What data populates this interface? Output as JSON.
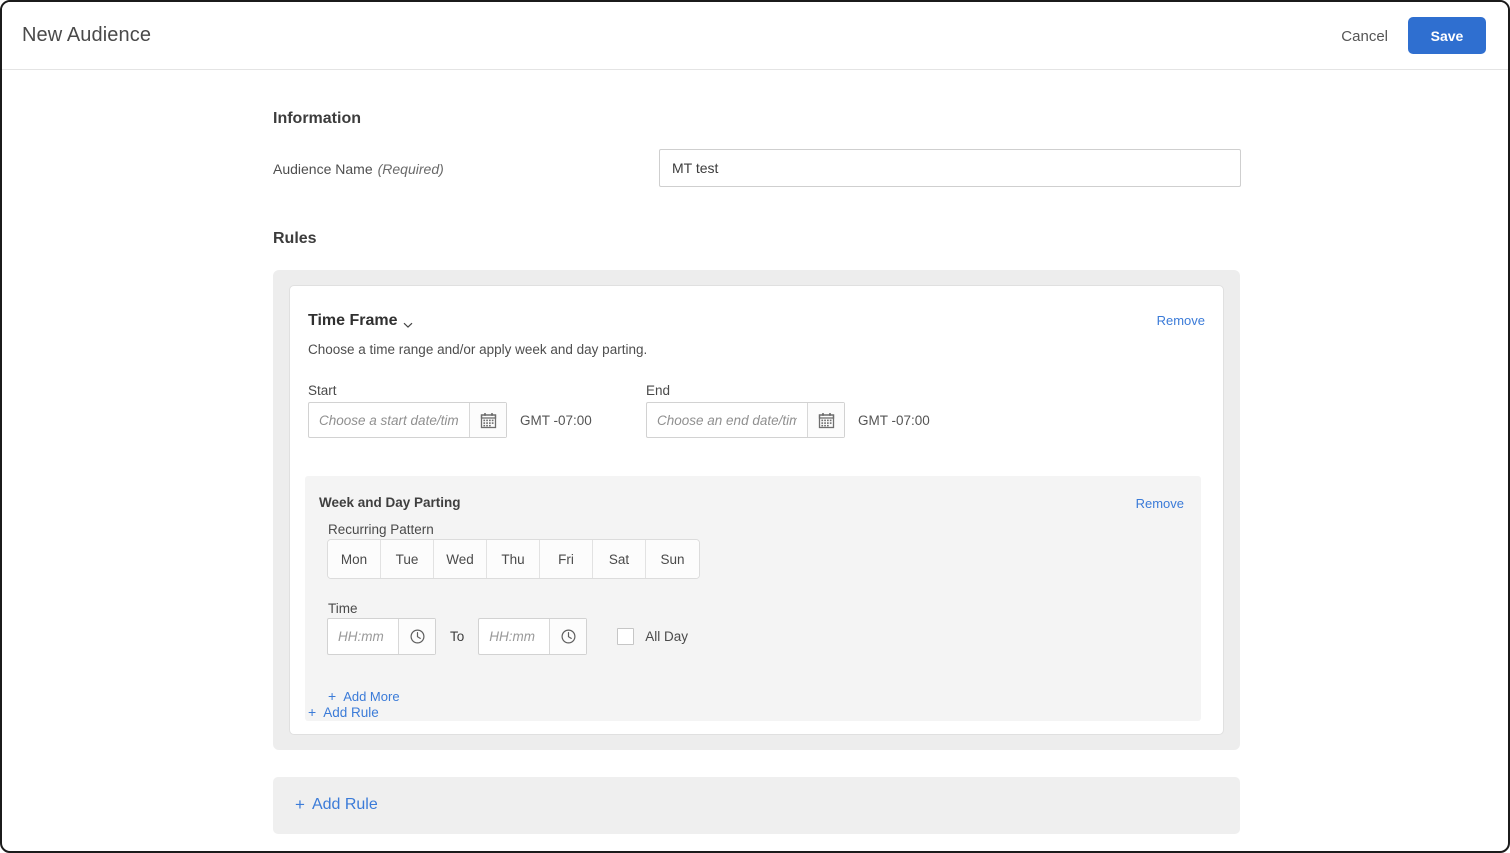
{
  "header": {
    "title": "New Audience",
    "cancel_label": "Cancel",
    "save_label": "Save"
  },
  "information": {
    "section_title": "Information",
    "audience_name": {
      "label": "Audience Name",
      "required_note": "(Required)",
      "value": "MT test",
      "placeholder": ""
    }
  },
  "rules": {
    "section_title": "Rules",
    "rule": {
      "title": "Time Frame",
      "chevron_icon": "chevron-down-icon",
      "description": "Choose a time range and/or apply week and day parting.",
      "remove_label": "Remove",
      "start": {
        "label": "Start",
        "placeholder": "Choose a start date/time",
        "value": "",
        "timezone": "GMT -07:00",
        "icon": "calendar-icon"
      },
      "end": {
        "label": "End",
        "placeholder": "Choose an end date/time",
        "value": "",
        "timezone": "GMT -07:00",
        "icon": "calendar-icon"
      },
      "parting": {
        "title": "Week and Day Parting",
        "remove_label": "Remove",
        "recurring_label": "Recurring Pattern",
        "days": [
          {
            "label": "Mon",
            "selected": false
          },
          {
            "label": "Tue",
            "selected": false
          },
          {
            "label": "Wed",
            "selected": false
          },
          {
            "label": "Thu",
            "selected": false
          },
          {
            "label": "Fri",
            "selected": false
          },
          {
            "label": "Sat",
            "selected": false
          },
          {
            "label": "Sun",
            "selected": false
          }
        ],
        "time_label": "Time",
        "time_from": {
          "placeholder": "HH:mm",
          "value": "",
          "icon": "clock-icon"
        },
        "time_to": {
          "placeholder": "HH:mm",
          "value": "",
          "icon": "clock-icon"
        },
        "to_separator": "To",
        "all_day": {
          "label": "All Day",
          "checked": false
        },
        "add_more_label": "Add More",
        "plus_symbol": "+"
      },
      "add_rule_label": "Add Rule",
      "plus_symbol": "+"
    },
    "add_rule_bottom": {
      "label": "Add Rule",
      "plus_symbol": "+"
    }
  },
  "colors": {
    "accent_blue": "#2f6fd0",
    "link_blue": "#3b7bd8",
    "panel_gray": "#ededed",
    "inner_panel_gray": "#f4f4f4"
  }
}
